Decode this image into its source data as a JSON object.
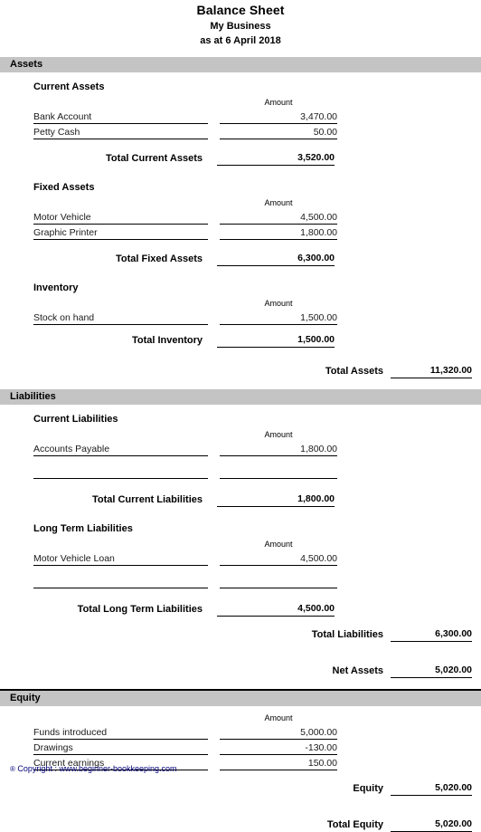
{
  "document": {
    "title": "Balance Sheet",
    "business_name": "My Business",
    "date_line": "as at 6 April 2018"
  },
  "labels": {
    "amount_header": "Amount"
  },
  "colors": {
    "section_bar_bg": "#c4c4c4",
    "rule": "#000000",
    "footer_text": "#00007a",
    "body_text": "#1a1a1a"
  },
  "sections": {
    "assets": {
      "bar_label": "Assets",
      "has_top_rule": false,
      "groups": {
        "current_assets": {
          "heading": "Current Assets",
          "amount_header": "Amount",
          "items": [
            {
              "label": "Bank Account",
              "amount": "3,470.00"
            },
            {
              "label": "Petty Cash",
              "amount": "50.00"
            }
          ],
          "total": {
            "label": "Total Current Assets",
            "amount": "3,520.00"
          }
        },
        "fixed_assets": {
          "heading": "Fixed Assets",
          "amount_header": "Amount",
          "items": [
            {
              "label": "Motor Vehicle",
              "amount": "4,500.00"
            },
            {
              "label": "Graphic Printer",
              "amount": "1,800.00"
            }
          ],
          "total": {
            "label": "Total Fixed Assets",
            "amount": "6,300.00"
          }
        },
        "inventory": {
          "heading": "Inventory",
          "amount_header": "Amount",
          "items": [
            {
              "label": "Stock on hand",
              "amount": "1,500.00"
            }
          ],
          "total": {
            "label": "Total Inventory",
            "amount": "1,500.00"
          }
        }
      },
      "grand_total": {
        "label": "Total Assets",
        "amount": "11,320.00"
      }
    },
    "liabilities": {
      "bar_label": "Liabilities",
      "has_top_rule": false,
      "groups": {
        "current_liabilities": {
          "heading": "Current Liabilities",
          "amount_header": "Amount",
          "items": [
            {
              "label": "Accounts Payable",
              "amount": "1,800.00"
            },
            {
              "label": "",
              "amount": ""
            }
          ],
          "total": {
            "label": "Total Current Liabilities",
            "amount": "1,800.00"
          }
        },
        "long_term_liabilities": {
          "heading": "Long Term Liabilities",
          "amount_header": "Amount",
          "items": [
            {
              "label": "Motor Vehicle Loan",
              "amount": "4,500.00"
            },
            {
              "label": "",
              "amount": ""
            }
          ],
          "total": {
            "label": "Total Long Term Liabilities",
            "amount": "4,500.00"
          }
        }
      },
      "grand_total": {
        "label": "Total Liabilities",
        "amount": "6,300.00"
      },
      "net_assets": {
        "label": "Net Assets",
        "amount": "5,020.00"
      }
    },
    "equity": {
      "bar_label": "Equity",
      "has_top_rule": true,
      "amount_header": "Amount",
      "items": [
        {
          "label": "Funds introduced",
          "amount": "5,000.00"
        },
        {
          "label": "Drawings",
          "amount": "-130.00"
        },
        {
          "label": "Current earnings",
          "amount": "150.00"
        }
      ],
      "subtotal": {
        "label": "Equity",
        "amount": "5,020.00"
      },
      "grand_total": {
        "label": "Total Equity",
        "amount": "5,020.00"
      }
    }
  },
  "footer": {
    "symbol": "®",
    "text": "Copyright : www.beginner-bookkeeping.com"
  }
}
